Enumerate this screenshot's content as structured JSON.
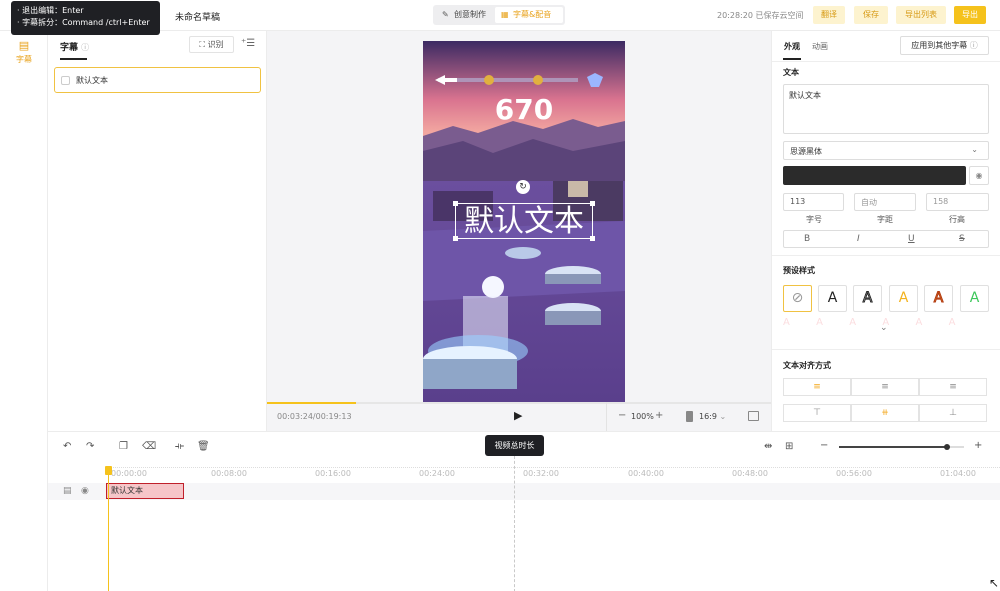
{
  "tooltip": {
    "line1": "· 退出编辑：Enter",
    "line2": "· 字幕拆分：Command /ctrl+Enter"
  },
  "header": {
    "draft_name": "未命名草稿",
    "mode_creative": "创意制作",
    "mode_subtitle": "字幕&配音",
    "save_status": "20:28:20 已保存云空间",
    "btn_translate": "翻译",
    "btn_save": "保存",
    "btn_export_list": "导出列表",
    "btn_export": "导出"
  },
  "rail": {
    "subtitle_label": "字幕"
  },
  "left_panel": {
    "tab_label": "字幕",
    "recognize_label": "识别",
    "subtitle_item_text": "默认文本"
  },
  "preview": {
    "game_score": "670",
    "overlay_text": "默认文本",
    "time_current": "00:03:24/00:19:13",
    "zoom": "100%",
    "ratio": "16:9",
    "progress_fraction": 0.177
  },
  "right_panel": {
    "tab_appearance": "外观",
    "tab_animation": "动画",
    "apply_other_btn": "应用到其他字幕",
    "text_section_title": "文本",
    "text_value": "默认文本",
    "font_family": "思源黑体",
    "font_size": "113",
    "letter_spacing": "自动",
    "line_height": "158",
    "label_size": "字号",
    "label_spacing": "字距",
    "label_line_height": "行高",
    "style_buttons": [
      "B",
      "I",
      "U",
      "S"
    ],
    "preset_title": "预设样式",
    "preset_glyph": "A",
    "align_title": "文本对齐方式",
    "text_color": "#2b2b2b"
  },
  "timeline": {
    "tooltip": "视频总时长",
    "ticks": [
      "00:00:00",
      "00:08:00",
      "00:16:00",
      "00:24:00",
      "00:32:00",
      "00:40:00",
      "00:48:00",
      "00:56:00",
      "01:04:00"
    ],
    "clip_text": "默认文本",
    "zoom_fraction": 0.86
  },
  "colors": {
    "accent": "#f5c21c",
    "accent_text": "#e8a21a",
    "clip_fill": "#f6c6c9",
    "clip_border": "#c0202b"
  }
}
